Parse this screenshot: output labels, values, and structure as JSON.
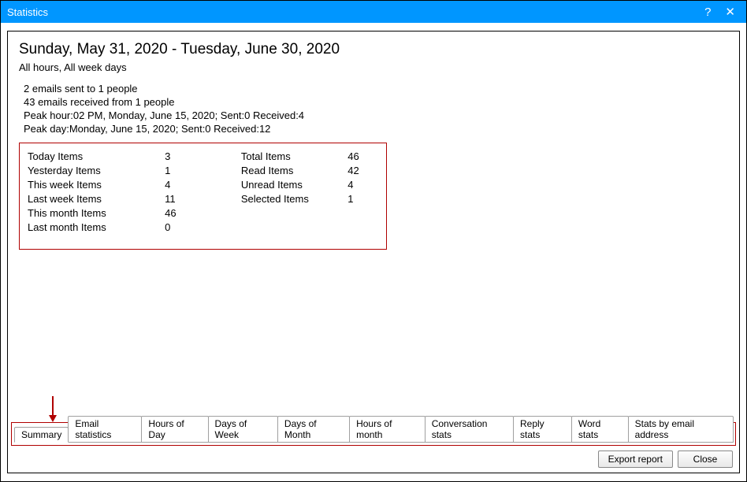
{
  "window": {
    "title": "Statistics"
  },
  "header": {
    "date_range": "Sunday, May 31, 2020 - Tuesday, June 30, 2020",
    "filter": "All hours, All week days"
  },
  "summary_lines": {
    "l0": "2 emails sent to 1 people",
    "l1": "43 emails received from 1 people",
    "l2": "Peak hour:02 PM, Monday, June 15, 2020; Sent:0 Received:4",
    "l3": "Peak day:Monday, June 15, 2020; Sent:0 Received:12"
  },
  "tableA": {
    "labels": {
      "r0": "Today Items",
      "r1": "Yesterday Items",
      "r2": "This week Items",
      "r3": "Last week Items",
      "r4": "This month Items",
      "r5": "Last month Items"
    },
    "values": {
      "r0": "3",
      "r1": "1",
      "r2": "4",
      "r3": "11",
      "r4": "46",
      "r5": "0"
    }
  },
  "tableB": {
    "labels": {
      "r0": "Total Items",
      "r1": "Read Items",
      "r2": "Unread Items",
      "r3": "Selected Items"
    },
    "values": {
      "r0": "46",
      "r1": "42",
      "r2": "4",
      "r3": "1"
    }
  },
  "tabs": {
    "t0": "Summary",
    "t1": "Email statistics",
    "t2": "Hours of Day",
    "t3": "Days of Week",
    "t4": "Days of Month",
    "t5": "Hours of month",
    "t6": "Conversation stats",
    "t7": "Reply stats",
    "t8": "Word stats",
    "t9": "Stats by email address"
  },
  "buttons": {
    "export": "Export report",
    "close": "Close"
  }
}
